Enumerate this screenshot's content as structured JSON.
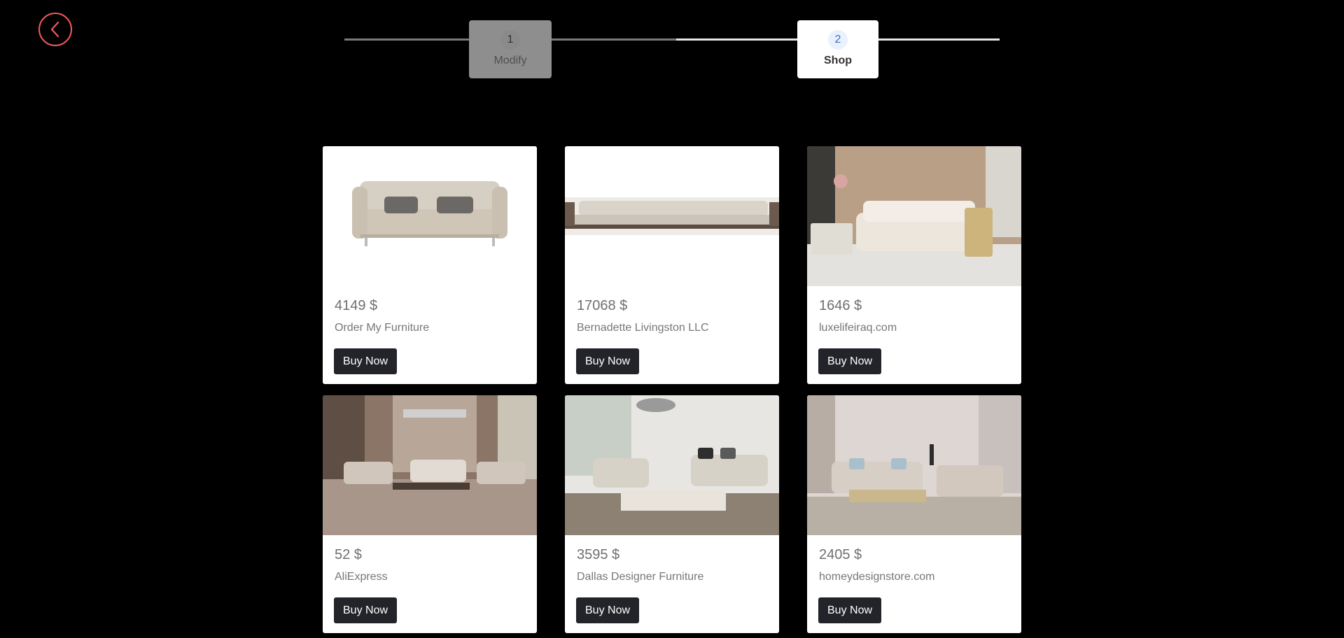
{
  "stepper": {
    "steps": [
      {
        "number": "1",
        "label": "Modify"
      },
      {
        "number": "2",
        "label": "Shop"
      }
    ],
    "current": 2
  },
  "products": [
    {
      "price": "4149 $",
      "seller": "Order My Furniture",
      "button": "Buy Now"
    },
    {
      "price": "17068 $",
      "seller": "Bernadette Livingston LLC",
      "button": "Buy Now"
    },
    {
      "price": "1646 $",
      "seller": "luxelifeiraq.com",
      "button": "Buy Now"
    },
    {
      "price": "52 $",
      "seller": "AliExpress",
      "button": "Buy Now"
    },
    {
      "price": "3595 $",
      "seller": "Dallas Designer Furniture",
      "button": "Buy Now"
    },
    {
      "price": "2405 $",
      "seller": "homeydesignstore.com",
      "button": "Buy Now"
    }
  ],
  "colors": {
    "back_icon": "#f05a5a",
    "button_bg": "#222429",
    "step_current_bg": "#ffffff",
    "step_prev_bg": "#8e8e8e"
  },
  "icons": {
    "back": "chevron-left-icon"
  }
}
